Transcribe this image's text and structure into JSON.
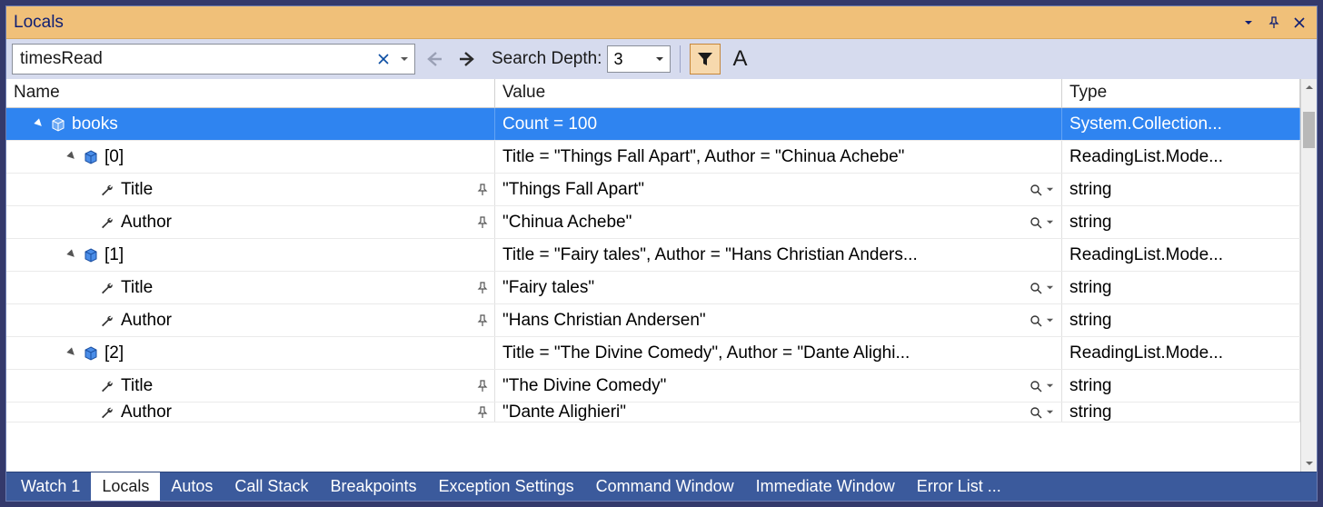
{
  "title": "Locals",
  "search": {
    "value": "timesRead"
  },
  "depth_label": "Search Depth:",
  "depth_value": "3",
  "columns": {
    "name": "Name",
    "value": "Value",
    "type": "Type"
  },
  "rows": [
    {
      "kind": "obj",
      "sel": true,
      "indent": 0,
      "name": "books",
      "value": "Count = 100",
      "type": "System.Collection...",
      "expander": true
    },
    {
      "kind": "obj",
      "sel": false,
      "indent": 1,
      "name": "[0]",
      "value": "Title = \"Things Fall Apart\", Author = \"Chinua Achebe\"",
      "type": "ReadingList.Mode...",
      "expander": true
    },
    {
      "kind": "prop",
      "sel": false,
      "indent": 2,
      "name": "Title",
      "value": "\"Things Fall Apart\"",
      "type": "string",
      "pin": true,
      "mag": true
    },
    {
      "kind": "prop",
      "sel": false,
      "indent": 2,
      "name": "Author",
      "value": "\"Chinua Achebe\"",
      "type": "string",
      "pin": true,
      "mag": true
    },
    {
      "kind": "obj",
      "sel": false,
      "indent": 1,
      "name": "[1]",
      "value": "Title = \"Fairy tales\", Author = \"Hans Christian Anders...",
      "type": "ReadingList.Mode...",
      "expander": true
    },
    {
      "kind": "prop",
      "sel": false,
      "indent": 2,
      "name": "Title",
      "value": "\"Fairy tales\"",
      "type": "string",
      "pin": true,
      "mag": true
    },
    {
      "kind": "prop",
      "sel": false,
      "indent": 2,
      "name": "Author",
      "value": "\"Hans Christian Andersen\"",
      "type": "string",
      "pin": true,
      "mag": true
    },
    {
      "kind": "obj",
      "sel": false,
      "indent": 1,
      "name": "[2]",
      "value": "Title = \"The Divine Comedy\", Author = \"Dante Alighi...",
      "type": "ReadingList.Mode...",
      "expander": true
    },
    {
      "kind": "prop",
      "sel": false,
      "indent": 2,
      "name": "Title",
      "value": "\"The Divine Comedy\"",
      "type": "string",
      "pin": true,
      "mag": true
    },
    {
      "kind": "prop",
      "sel": false,
      "indent": 2,
      "name": "Author",
      "value": "\"Dante Alighieri\"",
      "type": "string",
      "pin": true,
      "mag": true,
      "clipped": true
    }
  ],
  "tabs": [
    "Watch 1",
    "Locals",
    "Autos",
    "Call Stack",
    "Breakpoints",
    "Exception Settings",
    "Command Window",
    "Immediate Window",
    "Error List ..."
  ],
  "active_tab": 1
}
